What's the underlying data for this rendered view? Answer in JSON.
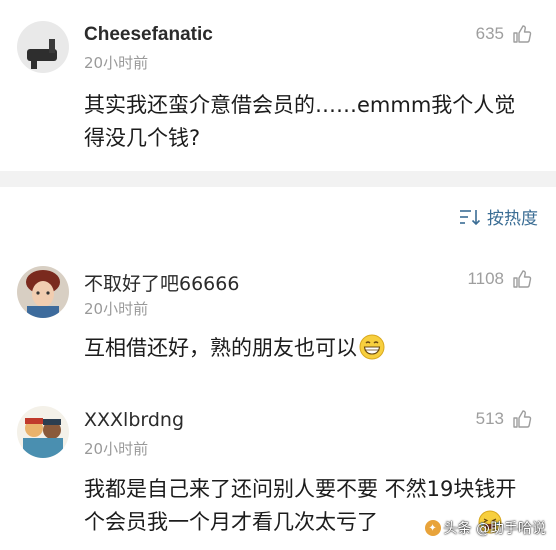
{
  "comments": [
    {
      "username": "Cheesefanatic",
      "time": "20小时前",
      "likes": "635",
      "text": "其实我还蛮介意借会员的……emmm我个人觉得没几个钱?"
    },
    {
      "username": "不取好了吧66666",
      "time": "20小时前",
      "likes": "1108",
      "text": "互相借还好，熟的朋友也可以"
    },
    {
      "username": "XXXlbrdng",
      "time": "20小时前",
      "likes": "513",
      "text": "我都是自己来了还问别人要不要 不然19块钱开个会员我一个月才看几次太亏了"
    }
  ],
  "sort": {
    "label": "按热度"
  },
  "watermark": {
    "text": "头条 @助手哈说"
  },
  "colors": {
    "link": "#3b6d94",
    "muted": "#9a9a9a",
    "separator": "#f2f2f2"
  },
  "icons": [
    "thumbs-up-icon",
    "sort-icon",
    "grin-emoji-icon",
    "laugh-emoji-icon"
  ]
}
